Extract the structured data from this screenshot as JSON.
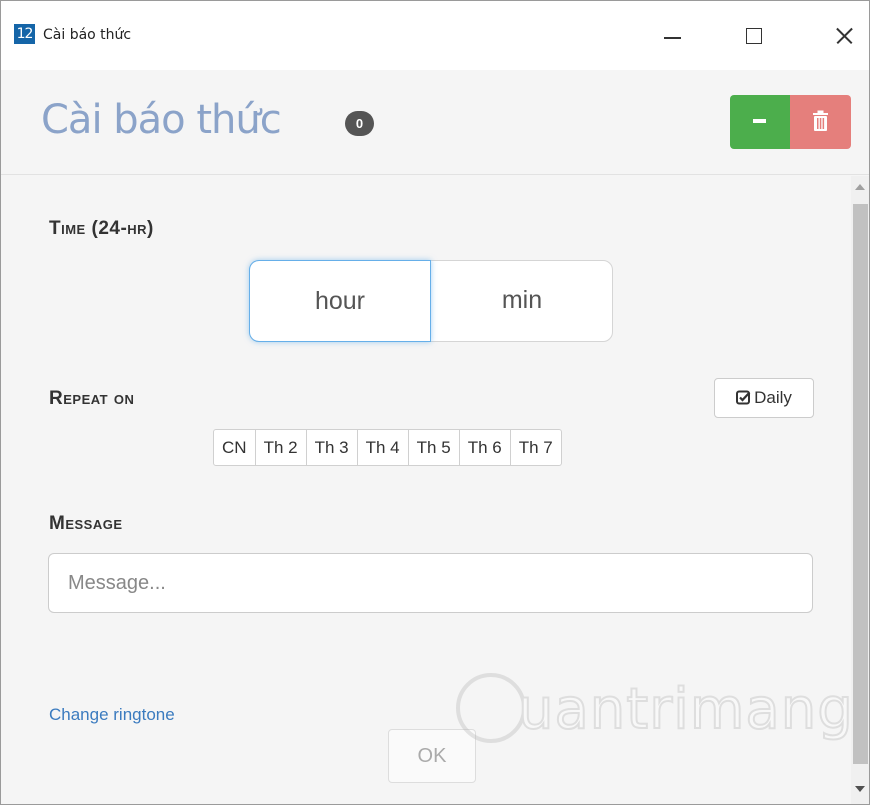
{
  "window": {
    "icon_text": "12",
    "title": "Cài báo thức",
    "controls": [
      "minimize",
      "maximize",
      "close"
    ]
  },
  "header": {
    "title": "Cài báo thức",
    "badge_count": "0",
    "minus_icon": "minus-icon",
    "trash_icon": "trash-icon",
    "minus_color": "#4cae4c",
    "trash_color": "#e57f7c"
  },
  "time": {
    "label": "Time (24-hr)",
    "hour_placeholder": "hour",
    "minute_placeholder": "min"
  },
  "repeat": {
    "label": "Repeat on",
    "daily_label": "Daily",
    "days": [
      "CN",
      "Th 2",
      "Th 3",
      "Th 4",
      "Th 5",
      "Th 6",
      "Th 7"
    ]
  },
  "message": {
    "label": "Message",
    "placeholder": "Message..."
  },
  "footer": {
    "ringtone_link": "Change ringtone",
    "ok_label": "OK"
  },
  "watermark": {
    "text": "uantrimang"
  }
}
